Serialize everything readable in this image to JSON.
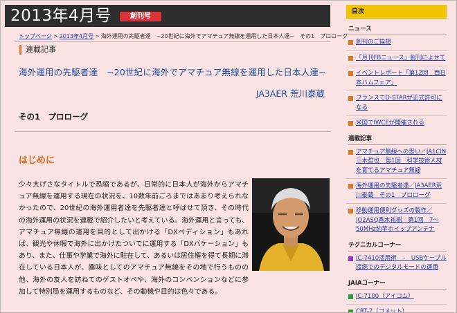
{
  "header": {
    "title": "2013年4月号",
    "badge": "創刊号"
  },
  "breadcrumb": {
    "items": [
      "トップページ",
      "2013年4月号"
    ],
    "current": "海外運用の先駆者達　~20世紀に海外でアマチュア無線を運用した日本人達~　その1　プロローグ"
  },
  "section_label": "連載記事",
  "article": {
    "title": "海外運用の先駆者達　~20世紀に海外でアマチュア無線を運用した日本人達~",
    "author": "JA3AER 荒川泰蔵",
    "part_title": "その1　プロローグ",
    "intro_heading": "はじめに",
    "body": "少々大げさなタイトルで恐縮であるが、日常的に日本人が海外からアマチュア無線を運用する現在の状況を、10数年前ごろまではあまり考えられなかったので、20世紀の海外運用者達を先駆者達と呼ばせて頂き、その時代の海外運用の状況を連載で紹介したいと考えている。海外運用と言っても、アマチュア無線の運用を目的として出かける「DXペディション」もあれば、観光や休暇で海外に出かけたついでに運用する「DXバケーション」もあり、また、仕事や学業で海外に駐在して、あるいは居住権を得て長期に滞在している日本人が、趣味としてのアマチュア無線をその地で行うものの他、海外の友人を訪ねてのゲストオペや、海外のコンベンションなどに参加して特別局を運用するものなど、その動機や目的は色々である。"
  },
  "sidebar": {
    "toc_label": "目次",
    "sections": [
      {
        "heading": "ニュース",
        "color": "#e07b24",
        "items": [
          "創刊のご挨拶",
          "「月刊FBニュース」創刊によせて",
          "イベントレポート「第12回　西日本ハムフェア」",
          "フランスでD-STARが正式許可になる",
          "米国でIWCEが開催される"
        ]
      },
      {
        "heading": "連載記事",
        "color": "#e07b24",
        "items": [
          "アマチュア無線への思い／JA1CIN三木哲也　第1回　科学技術人材を育てるアマチュア無線",
          "海外運用の先駆者達／JA3AER荒川泰蔵　その1　プロローグ",
          "移動運用便利グッズの製作／JO2ASQ香木祐樹　第1回　7～50MHz約竿ホイップアンテナ"
        ]
      },
      {
        "heading": "テクニカルコーナー",
        "color": "#9a35c8",
        "items": [
          "IC-7410活用術　–　USBケーブル接続でのデジタルモードの運用"
        ]
      },
      {
        "heading": "JAIAコーナー",
        "color": "#2e9e3a",
        "items": [
          "IC-7100（アイコム）",
          "CRT-7（コメット）"
        ]
      }
    ]
  }
}
